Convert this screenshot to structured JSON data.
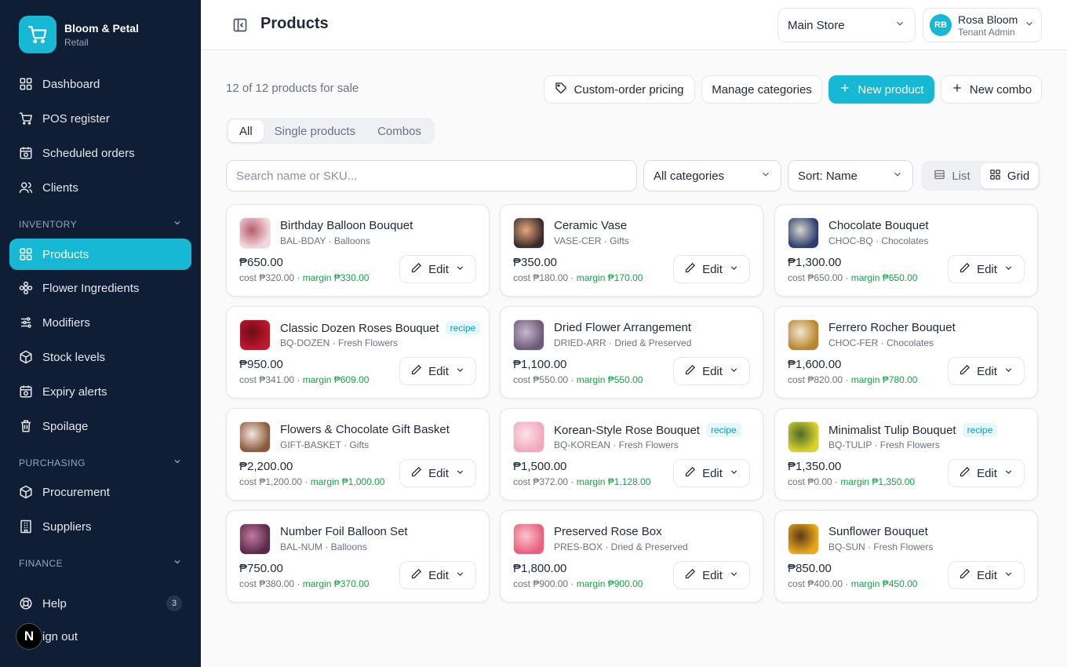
{
  "brand": {
    "name": "Bloom & Petal",
    "sub": "Retail"
  },
  "nav": {
    "dashboard": "Dashboard",
    "pos": "POS register",
    "scheduled": "Scheduled orders",
    "clients": "Clients",
    "inventory_label": "INVENTORY",
    "products": "Products",
    "ingredients": "Flower Ingredients",
    "modifiers": "Modifiers",
    "stock": "Stock levels",
    "expiry": "Expiry alerts",
    "spoilage": "Spoilage",
    "purchasing_label": "PURCHASING",
    "procurement": "Procurement",
    "suppliers": "Suppliers",
    "finance_label": "FINANCE",
    "help": "Help",
    "help_count": "3",
    "signout": "ign out",
    "n_badge": "N"
  },
  "header": {
    "title": "Products",
    "store": "Main Store",
    "user_initials": "RB",
    "user_name": "Rosa Bloom",
    "user_role": "Tenant Admin"
  },
  "toolbar": {
    "count": "12 of 12 products for sale",
    "custom_pricing": "Custom-order pricing",
    "manage_categories": "Manage categories",
    "new_product": "New product",
    "new_combo": "New combo"
  },
  "tabs": {
    "all": "All",
    "single": "Single products",
    "combos": "Combos"
  },
  "filters": {
    "search_placeholder": "Search name or SKU...",
    "category": "All categories",
    "sort": "Sort: Name",
    "list": "List",
    "grid": "Grid"
  },
  "edit_label": "Edit",
  "recipe_label": "recipe",
  "accent": "#17b8d4",
  "products": [
    {
      "name": "Birthday Balloon Bouquet",
      "sku": "BAL-BDAY · Balloons",
      "price": "₱650.00",
      "cost": "cost ₱320.00 · ",
      "margin": "margin ₱330.00",
      "recipe": false,
      "thumb": [
        "#f3d6dc",
        "#b55d6b"
      ]
    },
    {
      "name": "Ceramic Vase",
      "sku": "VASE-CER · Gifts",
      "price": "₱350.00",
      "cost": "cost ₱180.00 · ",
      "margin": "margin ₱170.00",
      "recipe": false,
      "thumb": [
        "#3a2a2a",
        "#e8a87c"
      ]
    },
    {
      "name": "Chocolate Bouquet",
      "sku": "CHOC-BQ · Chocolates",
      "price": "₱1,300.00",
      "cost": "cost ₱650.00 · ",
      "margin": "margin ₱650.00",
      "recipe": false,
      "thumb": [
        "#2c3e6b",
        "#d9d4cf"
      ]
    },
    {
      "name": "Classic Dozen Roses Bouquet",
      "sku": "BQ-DOZEN · Fresh Flowers",
      "price": "₱950.00",
      "cost": "cost ₱341.00 · ",
      "margin": "margin ₱609.00",
      "recipe": true,
      "thumb": [
        "#c0172a",
        "#6b0d17"
      ]
    },
    {
      "name": "Dried Flower Arrangement",
      "sku": "DRIED-ARR · Dried & Preserved",
      "price": "₱1,100.00",
      "cost": "cost ₱550.00 · ",
      "margin": "margin ₱550.00",
      "recipe": false,
      "thumb": [
        "#6b5a7a",
        "#c9b8c9"
      ]
    },
    {
      "name": "Ferrero Rocher Bouquet",
      "sku": "CHOC-FER · Chocolates",
      "price": "₱1,600.00",
      "cost": "cost ₱820.00 · ",
      "margin": "margin ₱780.00",
      "recipe": false,
      "thumb": [
        "#b8862b",
        "#f0e6d2"
      ]
    },
    {
      "name": "Flowers & Chocolate Gift Basket",
      "sku": "GIFT-BASKET · Gifts",
      "price": "₱2,200.00",
      "cost": "cost ₱1,200.00 · ",
      "margin": "margin ₱1,000.00",
      "recipe": false,
      "thumb": [
        "#8a5a3a",
        "#f5e6e0"
      ]
    },
    {
      "name": "Korean-Style Rose Bouquet",
      "sku": "BQ-KOREAN · Fresh Flowers",
      "price": "₱1,500.00",
      "cost": "cost ₱372.00 · ",
      "margin": "margin ₱1,128.00",
      "recipe": true,
      "thumb": [
        "#f2a7bd",
        "#fbe3ea"
      ]
    },
    {
      "name": "Minimalist Tulip Bouquet",
      "sku": "BQ-TULIP · Fresh Flowers",
      "price": "₱1,350.00",
      "cost": "cost ₱0.00 · ",
      "margin": "margin ₱1,350.00",
      "recipe": true,
      "thumb": [
        "#d8d22a",
        "#4a6b2a"
      ]
    },
    {
      "name": "Number Foil Balloon Set",
      "sku": "BAL-NUM · Balloons",
      "price": "₱750.00",
      "cost": "cost ₱380.00 · ",
      "margin": "margin ₱370.00",
      "recipe": false,
      "thumb": [
        "#5a2a4a",
        "#c27aa0"
      ]
    },
    {
      "name": "Preserved Rose Box",
      "sku": "PRES-BOX · Dried & Preserved",
      "price": "₱1,800.00",
      "cost": "cost ₱900.00 · ",
      "margin": "margin ₱900.00",
      "recipe": false,
      "thumb": [
        "#e8607a",
        "#f7c5d0"
      ]
    },
    {
      "name": "Sunflower Bouquet",
      "sku": "BQ-SUN · Fresh Flowers",
      "price": "₱850.00",
      "cost": "cost ₱400.00 · ",
      "margin": "margin ₱450.00",
      "recipe": false,
      "thumb": [
        "#e9a91a",
        "#5a3a1a"
      ]
    }
  ]
}
